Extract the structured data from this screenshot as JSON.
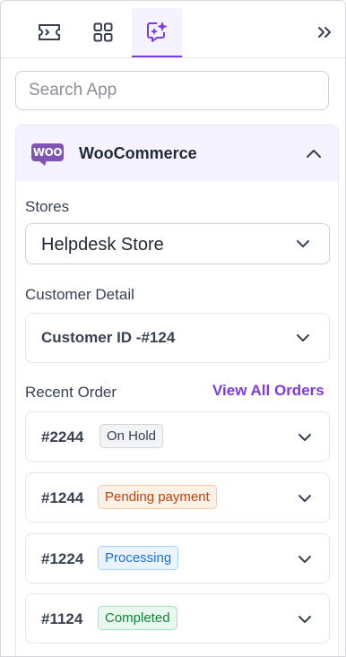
{
  "tabs": [
    {
      "icon": "ticket-icon",
      "active": false
    },
    {
      "icon": "apps-grid-icon",
      "active": false
    },
    {
      "icon": "ai-chat-sparkle-icon",
      "active": true
    }
  ],
  "collapse_icon": "double-chevron-right-icon",
  "search": {
    "placeholder": "Search App",
    "value": ""
  },
  "app": {
    "logo_text": "WOO",
    "title": "WooCommerce",
    "expanded": true,
    "brand_color": "#7f54b3",
    "stores": {
      "label": "Stores",
      "selected": "Helpdesk Store"
    },
    "customer": {
      "label": "Customer Detail",
      "selected": "Customer ID -#124"
    },
    "recent_orders": {
      "label": "Recent Order",
      "view_all": "View All Orders",
      "orders": [
        {
          "id": "#2244",
          "status": "On Hold",
          "status_color": "#374151"
        },
        {
          "id": "#1244",
          "status": "Pending payment",
          "status_color": "#c2410c"
        },
        {
          "id": "#1224",
          "status": "Processing",
          "status_color": "#1d6fd6"
        },
        {
          "id": "#1124",
          "status": "Completed",
          "status_color": "#15803d"
        }
      ]
    }
  },
  "accent_color": "#7c3aed"
}
